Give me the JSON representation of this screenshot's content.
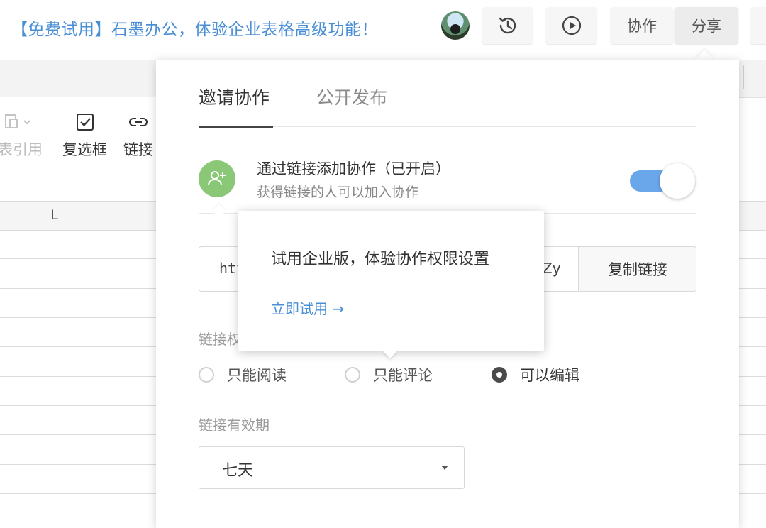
{
  "topbar": {
    "promo_text": "【免费试用】石墨办公，体验企业表格高级功能！",
    "avatar_alt": "user-avatar",
    "history_icon": "history-icon",
    "present_icon": "play-icon",
    "collab_label": "协作",
    "share_label": "分享"
  },
  "toolbar": {
    "items": [
      {
        "label": "跨表引用",
        "icon": "sheet-reference-icon",
        "disabled": true
      },
      {
        "label": "复选框",
        "icon": "checkbox-icon"
      },
      {
        "label": "链接",
        "icon": "link-icon"
      }
    ]
  },
  "grid": {
    "column_header": "L"
  },
  "share_panel": {
    "tabs": [
      {
        "label": "邀请协作",
        "active": true
      },
      {
        "label": "公开发布",
        "active": false
      }
    ],
    "link_collab": {
      "title": "通过链接添加协作（已开启）",
      "subtitle": "获得链接的人可以加入协作",
      "enabled": true
    },
    "link": {
      "text_start": "htt",
      "text_end": "Zy",
      "copy_label": "复制链接"
    },
    "permission": {
      "label": "链接权限",
      "options": [
        {
          "label": "只能阅读",
          "selected": false
        },
        {
          "label": "只能评论",
          "selected": false
        },
        {
          "label": "可以编辑",
          "selected": true
        }
      ]
    },
    "expiry": {
      "label": "链接有效期",
      "value": "七天"
    }
  },
  "upsell_tip": {
    "title": "试用企业版，体验协作权限设置",
    "link_label": "立即试用 →"
  },
  "colors": {
    "accent": "#4a8fd6",
    "toggle_on": "#6aa6ea",
    "green_icon": "#8ac878"
  }
}
